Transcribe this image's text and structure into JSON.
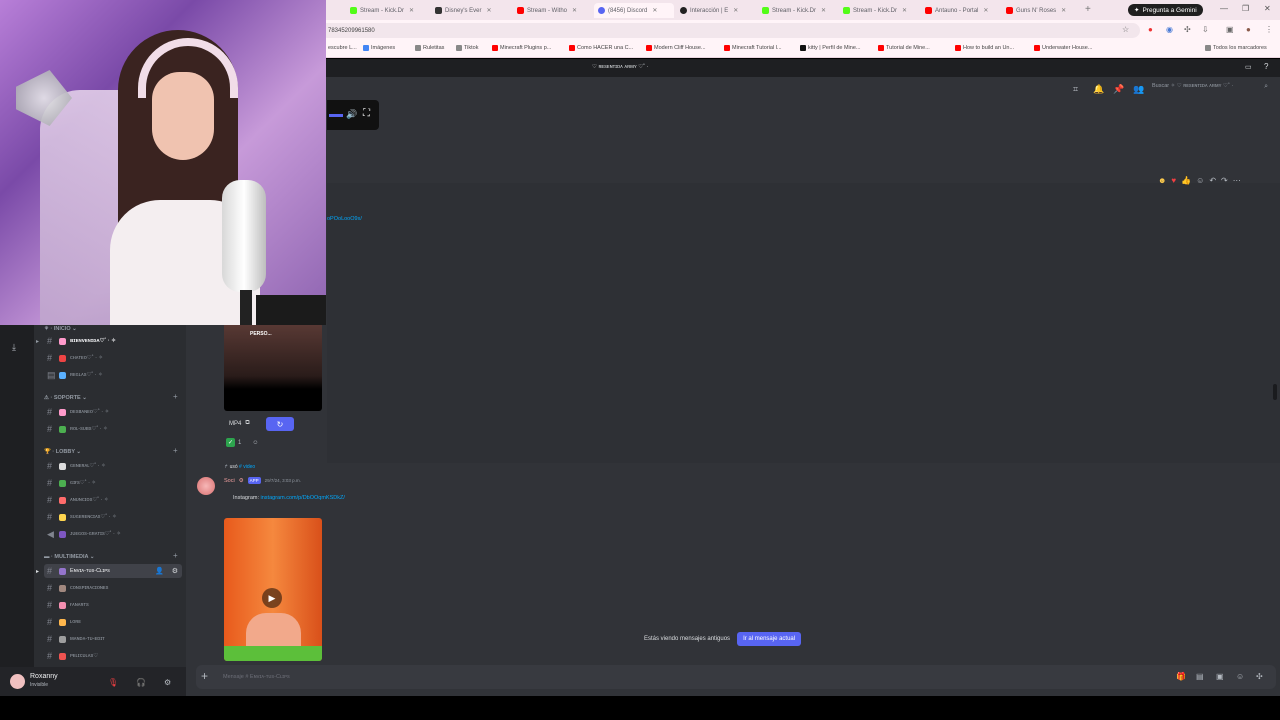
{
  "browser": {
    "tabs": [
      {
        "label": "Stream - Kick.Dr",
        "color": "#53fc18"
      },
      {
        "label": "Disney's Ever",
        "color": "#333333"
      },
      {
        "label": "Stream - Witho",
        "color": "#ff0000"
      },
      {
        "label": "(8456) Discord",
        "color": "#5865f2"
      },
      {
        "label": "Interacción | E",
        "color": "#222222"
      },
      {
        "label": "Stream - Kick.Dr",
        "color": "#53fc18"
      },
      {
        "label": "Stream - Kick.Dr",
        "color": "#53fc18"
      },
      {
        "label": "Antauno - Portal",
        "color": "#ff0000"
      },
      {
        "label": "Guns N' Roses",
        "color": "#ff0000"
      }
    ],
    "gemini_label": "Pregunta a Gemini",
    "url": "78345209961580",
    "bookmarks": [
      {
        "label": "Imágenes",
        "color": "#4285f4"
      },
      {
        "label": "Ruletitas",
        "color": "#888888"
      },
      {
        "label": "Tiktok",
        "color": "#888888"
      },
      {
        "label": "Minecraft Plugins p...",
        "color": "#ff0000"
      },
      {
        "label": "Como HACER una C...",
        "color": "#ff0000"
      },
      {
        "label": "Modern Cliff House...",
        "color": "#ff0000"
      },
      {
        "label": "Minecraft Tutorial l...",
        "color": "#ff0000"
      },
      {
        "label": "kitty | Perfil de Mine...",
        "color": "#111111"
      },
      {
        "label": "Tutorial de Mine...",
        "color": "#ff0000"
      },
      {
        "label": "How to build an Un...",
        "color": "#ff0000"
      },
      {
        "label": "Underwater House...",
        "color": "#ff0000"
      }
    ],
    "bookmark_first": "escubre L...",
    "all_bookmarks": "Todos los marcadores"
  },
  "discord": {
    "server_title": "♡ ʀᴇsᴇɴᴛɪᴅᴀ ᴀʀᴍʏ ♡˚ ·",
    "search_placeholder": "Buscar ✧ ♡ ʀᴇsᴇɴᴛɪᴅᴀ ᴀʀᴍʏ ♡˚ ·",
    "categories": {
      "inicio": "INICIO",
      "soporte": "SOPORTE",
      "lobby": "LOBBY",
      "multimedia": "MULTIMEDIA"
    },
    "channels": [
      {
        "label": "ʙɪᴇɴᴠᴇɴɪᴅᴀ♡˚ · ✧",
        "color": "#ff9acb"
      },
      {
        "label": "ᴄʜᴀᴛᴇᴏ♡˚ · ✧",
        "color": "#e44"
      },
      {
        "label": "ʀᴇɢʟᴀs♡˚ · ✧",
        "color": "#5ab0ff"
      },
      {
        "label": "ᴅᴇsʙᴀɴᴇᴏ♡˚ · ✧",
        "color": "#ff9acb"
      },
      {
        "label": "ʀᴏʟ-sᴜʙs♡˚ · ✧",
        "color": "#4caf50"
      },
      {
        "label": "ɢᴇɴᴇʀᴀʟ♡˚ · ✧",
        "color": "#ddd"
      },
      {
        "label": "ɢɪғs♡˚ · ✧",
        "color": "#4caf50"
      },
      {
        "label": "ᴀɴᴜɴᴄɪᴏs♡˚ · ✧",
        "color": "#ff6b6b"
      },
      {
        "label": "sᴜɢᴇʀᴇɴᴄɪᴀs♡˚ · ✧",
        "color": "#ffd54f"
      },
      {
        "label": "ᴊᴜᴇɢᴏs-ɢʀᴀᴛɪs♡˚ · ✧",
        "color": "#7e57c2"
      },
      {
        "label": "Eɴᴠɪᴀ-ᴛᴜs-Cʟɪᴘs",
        "color": "#9575cd"
      },
      {
        "label": "ᴄᴏɴsᴘɪʀᴀᴄɪᴏɴᴇs",
        "color": "#a1887f"
      },
      {
        "label": "ғᴀɴᴀʀᴛs",
        "color": "#f48fb1"
      },
      {
        "label": "ʟᴏʀᴇ",
        "color": "#ffb74d"
      },
      {
        "label": "ᴍᴀɴᴅᴀ-ᴛᴜ-ᴇᴅɪᴛ",
        "color": "#9e9e9e"
      },
      {
        "label": "ᴘᴇʟɪᴄᴜʟᴀs♡",
        "color": "#ef5350"
      }
    ],
    "user": {
      "name": "Roxanny",
      "status": "Invisible"
    },
    "messages": {
      "link_top": "oPOoLooO9x/",
      "thumb1_caption": "PERSO...",
      "mp4_label": "MP4",
      "reaction_count": "1",
      "system_line_prefix": "usó",
      "system_line_cmd": "# video",
      "author_badge": "APP",
      "author_name": "Soci",
      "timestamp": "29/7/24, 3:03 p.m.",
      "instagram_label": "Instagram:",
      "instagram_link": "instagram.com/p/DbOOqmKSDkZ/"
    },
    "old_notice": "Estás viendo mensajes antiguos",
    "jump_label": "Ir al mensaje actual",
    "composer_placeholder": "Mensaje # Eɴᴠɪᴀ-ᴛᴜs-Cʟɪᴘs"
  }
}
